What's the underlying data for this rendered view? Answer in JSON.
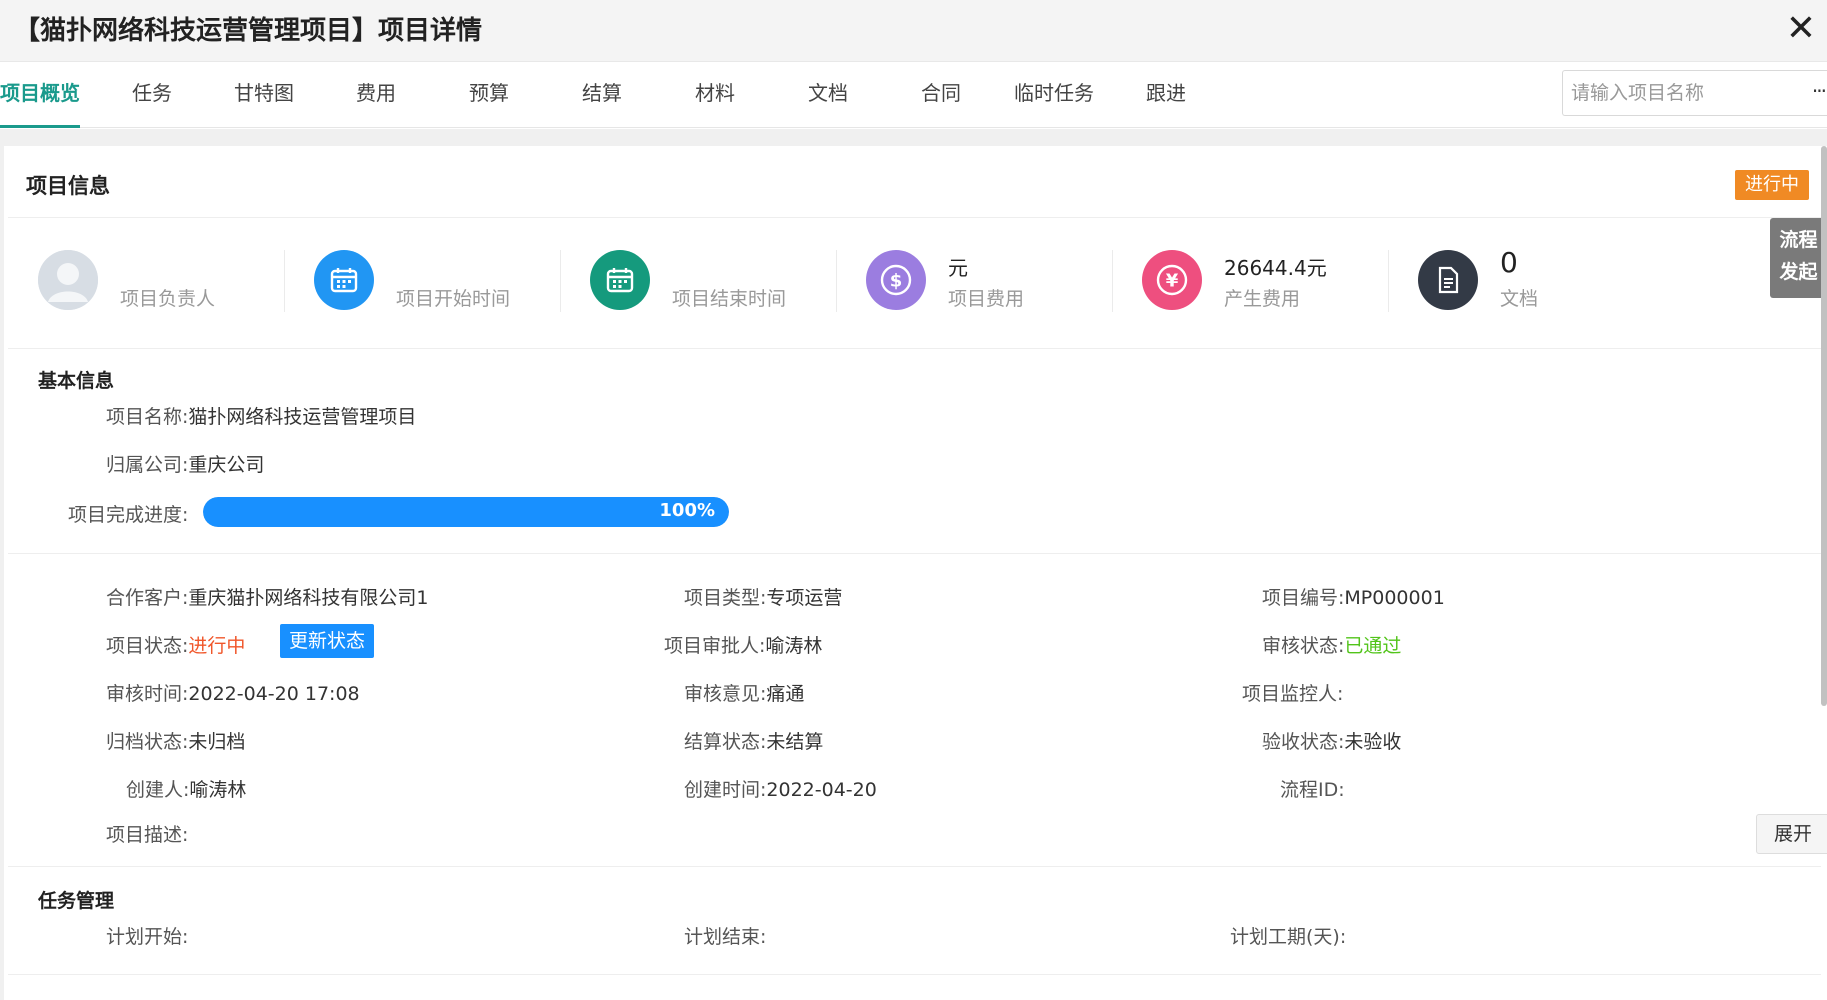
{
  "header": {
    "title": "【猫扑网络科技运营管理项目】项目详情"
  },
  "tabs": [
    "项目概览",
    "任务",
    "甘特图",
    "费用",
    "预算",
    "结算",
    "材料",
    "文档",
    "合同",
    "临时任务",
    "跟进"
  ],
  "search": {
    "placeholder": "请输入项目名称",
    "more": "···"
  },
  "section": {
    "title": "项目信息",
    "status_pill": "进行中"
  },
  "flow_tab": {
    "line1": "流程",
    "line2": "发起"
  },
  "stats": {
    "manager_label": "项目负责人",
    "start_label": "项目开始时间",
    "end_label": "项目结束时间",
    "cost_value": "元",
    "cost_label": "项目费用",
    "generated_value": "26644.4元",
    "generated_label": "产生费用",
    "docs_value": "0",
    "docs_label": "文档"
  },
  "basic": {
    "title": "基本信息",
    "name_key": "项目名称:",
    "name_val": "猫扑网络科技运营管理项目",
    "company_key": "归属公司:",
    "company_val": "重庆公司",
    "progress_key": "项目完成进度:",
    "progress_pct": 100,
    "progress_text": "100%"
  },
  "details": {
    "customer_key": "合作客户:",
    "customer_val": "重庆猫扑网络科技有限公司1",
    "type_key": "项目类型:",
    "type_val": "专项运营",
    "code_key": "项目编号:",
    "code_val": "MP000001",
    "status_key": "项目状态:",
    "status_val": "进行中",
    "update_btn": "更新状态",
    "approver_key": "项目审批人:",
    "approver_val": "喻涛林",
    "audit_status_key": "审核状态:",
    "audit_status_val": "已通过",
    "audit_time_key": "审核时间:",
    "audit_time_val": "2022-04-20 17:08",
    "audit_opinion_key": "审核意见:",
    "audit_opinion_val": "痛通",
    "monitor_key": "项目监控人:",
    "monitor_val": "",
    "archive_key": "归档状态:",
    "archive_val": "未归档",
    "settle_key": "结算状态:",
    "settle_val": "未结算",
    "accept_key": "验收状态:",
    "accept_val": "未验收",
    "creator_key": "创建人:",
    "creator_val": "喻涛林",
    "created_key": "创建时间:",
    "created_val": "2022-04-20",
    "flow_key": "流程ID:",
    "flow_val": "",
    "desc_key": "项目描述:",
    "desc_val": "",
    "expand_btn": "展开"
  },
  "tasks": {
    "title": "任务管理",
    "plan_start_key": "计划开始:",
    "plan_end_key": "计划结束:",
    "plan_days_key": "计划工期(天):"
  },
  "colors": {
    "accent": "#1a9a8c",
    "status_orange": "#f08a24",
    "progress_blue": "#1890ff",
    "passed_green": "#52c41a"
  }
}
